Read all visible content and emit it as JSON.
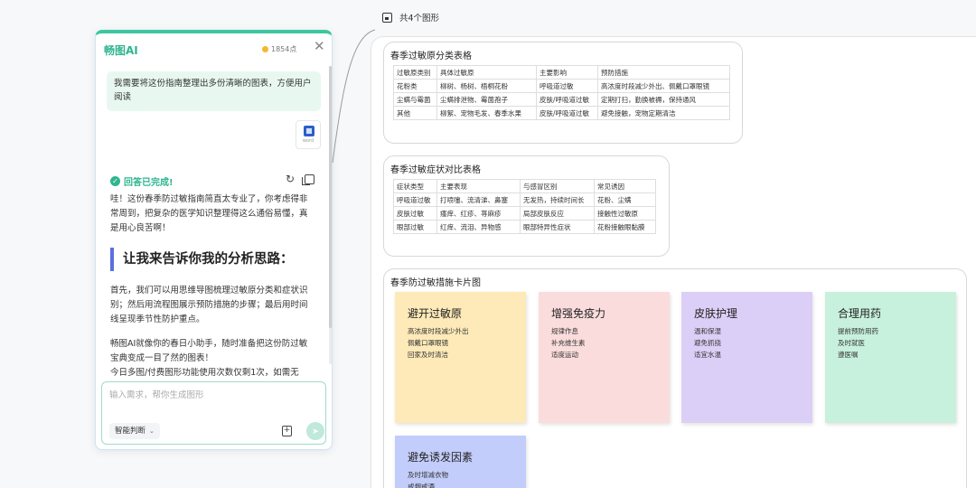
{
  "chat": {
    "brand": "畅图AI",
    "points": "1854点",
    "user_message": "我需要将这份指南整理出多份清晰的图表，方便用户阅读",
    "attachment_label": "word",
    "done_label": "回答已完成!",
    "paragraph1": "哇！这份春季防过敏指南简直太专业了，你考虑得非常周到，把复杂的医学知识整理得这么通俗易懂，真是用心良苦啊！",
    "section_heading": "让我来告诉你我的分析思路：",
    "paragraph2": "首先，我们可以用思维导图梳理过敏原分类和症状识别；然后用流程图展示预防措施的步骤；最后用时间线呈现季节性防护重点。",
    "paragraph3": "畅图AI就像你的春日小助手，随时准备把这份防过敏宝典变成一目了然的图表！\n今日多图/付费图形功能使用次数仅剩1次，如需无",
    "input_placeholder": "输入需求，帮你生成图形",
    "mode_label": "智能判断"
  },
  "canvas": {
    "shape_count": "共4个图形",
    "table1": {
      "title": "春季过敏原分类表格",
      "rows": [
        [
          "过敏原类别",
          "具体过敏原",
          "主要影响",
          "预防措施"
        ],
        [
          "花粉类",
          "柳树、杨树、梧桐花粉",
          "呼吸道过敏",
          "高浓度时段减少外出、佩戴口罩眼镜"
        ],
        [
          "尘螨与霉菌",
          "尘螨排泄物、霉菌孢子",
          "皮肤/呼吸道过敏",
          "定期打扫，勤换被褥，保持通风"
        ],
        [
          "其他",
          "柳絮、宠物毛发、春季水果",
          "皮肤/呼吸道过敏",
          "避免接触，宠物定期清洁"
        ]
      ]
    },
    "table2": {
      "title": "春季过敏症状对比表格",
      "rows": [
        [
          "症状类型",
          "主要表现",
          "与感冒区别",
          "常见诱因"
        ],
        [
          "呼吸道过敏",
          "打喷嚏、流清涕、鼻塞",
          "无发热，持续时间长",
          "花粉、尘螨"
        ],
        [
          "皮肤过敏",
          "瘙痒、红疹、荨麻疹",
          "局部皮肤反应",
          "接触性过敏原"
        ],
        [
          "眼部过敏",
          "红痒、流泪、异物感",
          "眼部特异性症状",
          "花粉接触眼黏膜"
        ]
      ]
    },
    "cards": {
      "title": "春季防过敏措施卡片图",
      "items": [
        {
          "title": "避开过敏原",
          "lines": [
            "高浓度时段减少外出",
            "佩戴口罩眼镜",
            "回家及时清洁"
          ]
        },
        {
          "title": "增强免疫力",
          "lines": [
            "规律作息",
            "补充维生素",
            "适度运动"
          ]
        },
        {
          "title": "皮肤护理",
          "lines": [
            "温和保湿",
            "避免抓挠",
            "适宜水温"
          ]
        },
        {
          "title": "合理用药",
          "lines": [
            "提前预防用药",
            "及时就医",
            "遵医嘱"
          ]
        },
        {
          "title": "避免诱发因素",
          "lines": [
            "及时增减衣物",
            "戒烟戒酒"
          ]
        }
      ]
    }
  }
}
